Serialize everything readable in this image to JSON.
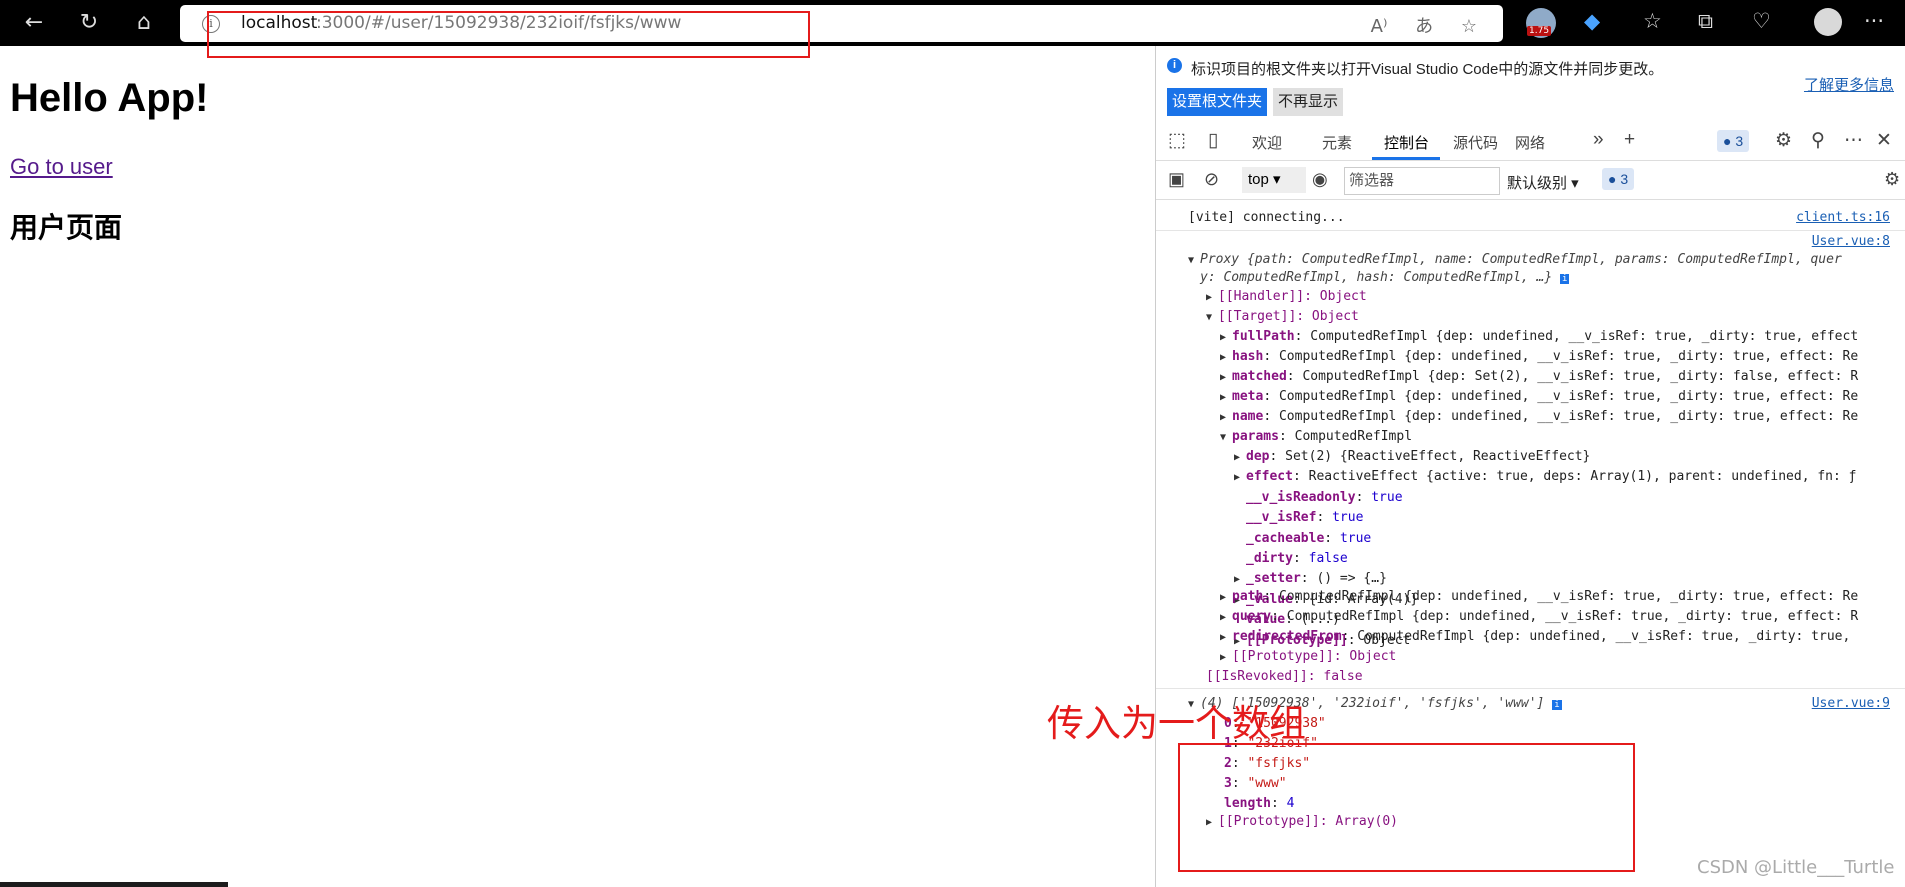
{
  "browser": {
    "url_host": "localhost",
    "url_path": ":3000/#/user/15092938/232ioif/fsfjks/www",
    "ext_badge": "1.75",
    "icons": [
      "back-icon",
      "refresh-icon",
      "home-icon",
      "info-icon",
      "read-aloud-icon",
      "translate-icon",
      "favorite-add-icon",
      "extension-icon",
      "gem-icon",
      "favorites-icon",
      "collections-icon",
      "health-icon",
      "avatar-icon",
      "more-icon"
    ]
  },
  "page": {
    "title": "Hello App!",
    "link": "Go to user",
    "subtitle": "用户页面"
  },
  "devtools": {
    "notice": "标识项目的根文件夹以打开Visual Studio Code中的源文件并同步更改。",
    "learn_more": "了解更多信息",
    "btn_set_root": "设置根文件夹",
    "btn_dismiss": "不再显示",
    "tabs": [
      "欢迎",
      "元素",
      "控制台",
      "源代码",
      "网络"
    ],
    "active_tab": "控制台",
    "msg_count": "3",
    "context": "top",
    "filter_placeholder": "筛选器",
    "level": "默认级别",
    "filter_msg_count": "3",
    "console": {
      "vite_msg": "[vite] connecting...",
      "vite_src": "client.ts:16",
      "src8": "User.vue:8",
      "proxy_l1": "Proxy {path: ComputedRefImpl, name: ComputedRefImpl, params: ComputedRefImpl, quer",
      "proxy_l2": "y: ComputedRefImpl, hash: ComputedRefImpl, …}",
      "handler": "[[Handler]]: Object",
      "target": "[[Target]]: Object",
      "rows": [
        {
          "key": "fullPath",
          "val": "ComputedRefImpl {dep: undefined, __v_isRef: true, _dirty: true, effect"
        },
        {
          "key": "hash",
          "val": "ComputedRefImpl {dep: undefined, __v_isRef: true, _dirty: true, effect: Re"
        },
        {
          "key": "matched",
          "val": "ComputedRefImpl {dep: Set(2), __v_isRef: true, _dirty: false, effect: R"
        },
        {
          "key": "meta",
          "val": "ComputedRefImpl {dep: undefined, __v_isRef: true, _dirty: true, effect: Re"
        },
        {
          "key": "name",
          "val": "ComputedRefImpl {dep: undefined, __v_isRef: true, _dirty: true, effect: Re"
        }
      ],
      "params_key": "params",
      "params_val": "ComputedRefImpl",
      "params_rows": [
        {
          "key": "dep",
          "val": "Set(2) {ReactiveEffect, ReactiveEffect}",
          "tri": true
        },
        {
          "key": "effect",
          "val": "ReactiveEffect {active: true, deps: Array(1), parent: undefined, fn: ƒ",
          "tri": true
        },
        {
          "key": "__v_isReadonly",
          "val": "true",
          "tri": false
        },
        {
          "key": "__v_isRef",
          "val": "true",
          "tri": false
        },
        {
          "key": "_cacheable",
          "val": "true",
          "tri": false
        },
        {
          "key": "_dirty",
          "val": "false",
          "tri": false
        },
        {
          "key": "_setter",
          "val": "() => {…}",
          "tri": true
        },
        {
          "key": "_value",
          "val": "{id: Array(4)}",
          "tri": true
        },
        {
          "key": "value",
          "val": "(...)",
          "tri": false
        },
        {
          "key": "[[Prototype]]",
          "val": "Object",
          "tri": true
        }
      ],
      "rows2": [
        {
          "key": "path",
          "val": "ComputedRefImpl {dep: undefined, __v_isRef: true, _dirty: true, effect: Re"
        },
        {
          "key": "query",
          "val": "ComputedRefImpl {dep: undefined, __v_isRef: true, _dirty: true, effect: R"
        },
        {
          "key": "redirectedFrom",
          "val": "ComputedRefImpl {dep: undefined, __v_isRef: true, _dirty: true,"
        }
      ],
      "proto_obj": "[[Prototype]]: Object",
      "revoked": "[[IsRevoked]]: false",
      "src9": "User.vue:9",
      "array_summary": "(4) ['15092938', '232ioif', 'fsfjks', 'www']",
      "array_items": [
        {
          "idx": "0",
          "val": "\"15092938\""
        },
        {
          "idx": "1",
          "val": "\"232ioif\""
        },
        {
          "idx": "2",
          "val": "\"fsfjks\""
        },
        {
          "idx": "3",
          "val": "\"www\""
        }
      ],
      "length_key": "length",
      "length_val": "4",
      "array_proto": "[[Prototype]]: Array(0)"
    }
  },
  "annotation": "传入为一个数组",
  "watermark": "CSDN @Little___Turtle",
  "colors": {
    "highlight_red": "#e41b1b",
    "accent_blue": "#1a73e8"
  }
}
